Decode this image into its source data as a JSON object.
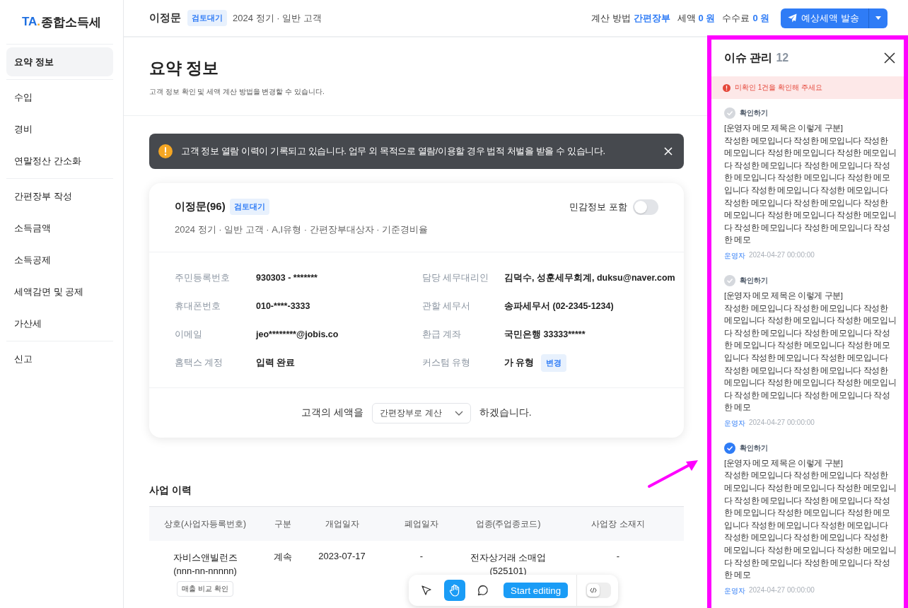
{
  "logo": {
    "mark": "TA",
    "dot": ".",
    "title": "종합소득세"
  },
  "sidebar": {
    "groups": [
      [
        {
          "label": "요약 정보",
          "selected": true
        }
      ],
      [
        {
          "label": "수입",
          "selected": false
        },
        {
          "label": "경비",
          "selected": false
        },
        {
          "label": "연말정산 간소화",
          "selected": false
        }
      ],
      [
        {
          "label": "간편장부 작성",
          "selected": false
        },
        {
          "label": "소득금액",
          "selected": false
        },
        {
          "label": "소득공제",
          "selected": false
        },
        {
          "label": "세액감면 및 공제",
          "selected": false
        },
        {
          "label": "가산세",
          "selected": false
        }
      ],
      [
        {
          "label": "신고",
          "selected": false
        }
      ]
    ]
  },
  "header": {
    "name": "이정문",
    "status": "검토대기",
    "meta": "2024 정기 · 일반 고객",
    "summary": [
      {
        "label": "계산 방법",
        "value": "간편장부"
      },
      {
        "label": "세액",
        "value": "0 원"
      },
      {
        "label": "수수료",
        "value": "0 원"
      }
    ],
    "send_button": "예상세액 발송"
  },
  "page": {
    "title": "요약 정보",
    "subtitle": "고객 정보 확인 및 세액 계산 방법을 변경할 수 있습니다."
  },
  "notice": {
    "text": "고객 정보 열람 이력이 기록되고 있습니다. 업무 외 목적으로 열람/이용할 경우 법적 처벌을 받을 수 있습니다."
  },
  "customer_card": {
    "name": "이정문(96)",
    "status": "검토대기",
    "meta": "2024 정기 · 일반 고객 · A,I유형 · 간편장부대상자 · 기준경비율",
    "sensitive_toggle": {
      "label": "민감정보 포함",
      "on": false
    },
    "fields": [
      {
        "label": "주민등록번호",
        "value": "930303  -  *******"
      },
      {
        "label": "담당 세무대리인",
        "value": "김덕수, 성훈세무회계, duksu@naver.com"
      },
      {
        "label": "휴대폰번호",
        "value": "010-****-3333"
      },
      {
        "label": "관할 세무서",
        "value": "송파세무서 (02-2345-1234)"
      },
      {
        "label": "이메일",
        "value": "jeo********@jobis.co"
      },
      {
        "label": "환급 계좌",
        "value": "국민은행  33333*****"
      },
      {
        "label": "홈택스 계정",
        "value": "입력 완료"
      },
      {
        "label": "커스텀 유형",
        "value": "가 유형",
        "action": "변경"
      }
    ],
    "calc": {
      "prefix": "고객의 세액을",
      "select": "간편장부로 계산",
      "suffix": "하겠습니다."
    }
  },
  "business_history": {
    "title": "사업 이력",
    "columns": [
      "상호(사업자등록번호)",
      "구분",
      "개업일자",
      "폐업일자",
      "업종(주업종코드)",
      "사업장 소재지"
    ],
    "rows": [
      {
        "name": "자비스앤빌런즈",
        "reg_no": "(nnn-nn-nnnnn)",
        "action": "매출 비교 확인",
        "type": "계속",
        "opened": "2023-07-17",
        "closed": "-",
        "industry": "전자상거래 소매업",
        "industry_code": "(525101)",
        "location": "-"
      }
    ]
  },
  "issue_panel": {
    "title": "이슈 관리",
    "count": "12",
    "alert": "미확인 1건을 확인해 주세요",
    "items": [
      {
        "confirm_label": "확인하기",
        "checked": false,
        "title": "[운영자 메모 제목은 이렇게 구분]",
        "body": "작성한 메모입니다 작성한 메모입니다 작성한 메모입니다 작성한 메모입니다 작성한 메모입니다 작성한 메모입니다 작성한 메모입니다 작성한 메모입니다 작성한 메모입니다 작성한 메모입니다 작성한 메모입니다 작성한 메모입니다 작성한 메모입니다 작성한 메모입니다 작성한 메모입니다 작성한 메모입니다 작성한 메모입니다 작성한 메모입니다 작성한 메모입니다 작성한 메모",
        "author": "운영자",
        "date": "2024-04-27 00:00:00"
      },
      {
        "confirm_label": "확인하기",
        "checked": false,
        "title": "[운영자 메모 제목은 이렇게 구분]",
        "body": "작성한 메모입니다 작성한 메모입니다 작성한 메모입니다 작성한 메모입니다 작성한 메모입니다 작성한 메모입니다 작성한 메모입니다 작성한 메모입니다 작성한 메모입니다 작성한 메모입니다 작성한 메모입니다 작성한 메모입니다 작성한 메모입니다 작성한 메모입니다 작성한 메모입니다 작성한 메모입니다 작성한 메모입니다 작성한 메모입니다 작성한 메모입니다 작성한 메모",
        "author": "운영자",
        "date": "2024-04-27 00:00:00"
      },
      {
        "confirm_label": "확인하기",
        "checked": true,
        "title": "[운영자 메모 제목은 이렇게 구분]",
        "body": "작성한 메모입니다 작성한 메모입니다 작성한 메모입니다 작성한 메모입니다 작성한 메모입니다 작성한 메모입니다 작성한 메모입니다 작성한 메모입니다 작성한 메모입니다 작성한 메모입니다 작성한 메모입니다 작성한 메모입니다 작성한 메모입니다 작성한 메모입니다 작성한 메모입니다 작성한 메모입니다 작성한 메모입니다 작성한 메모입니다 작성한 메모입니다 작성한 메모",
        "author": "운영자",
        "date": "2024-04-27 00:00:00"
      }
    ]
  },
  "editor_toolbar": {
    "tools": [
      {
        "kind": "pointer",
        "selected": false
      },
      {
        "kind": "hand",
        "selected": true
      },
      {
        "kind": "comment",
        "selected": false
      }
    ],
    "start_button": "Start editing",
    "code_toggle": {
      "on": false
    }
  }
}
